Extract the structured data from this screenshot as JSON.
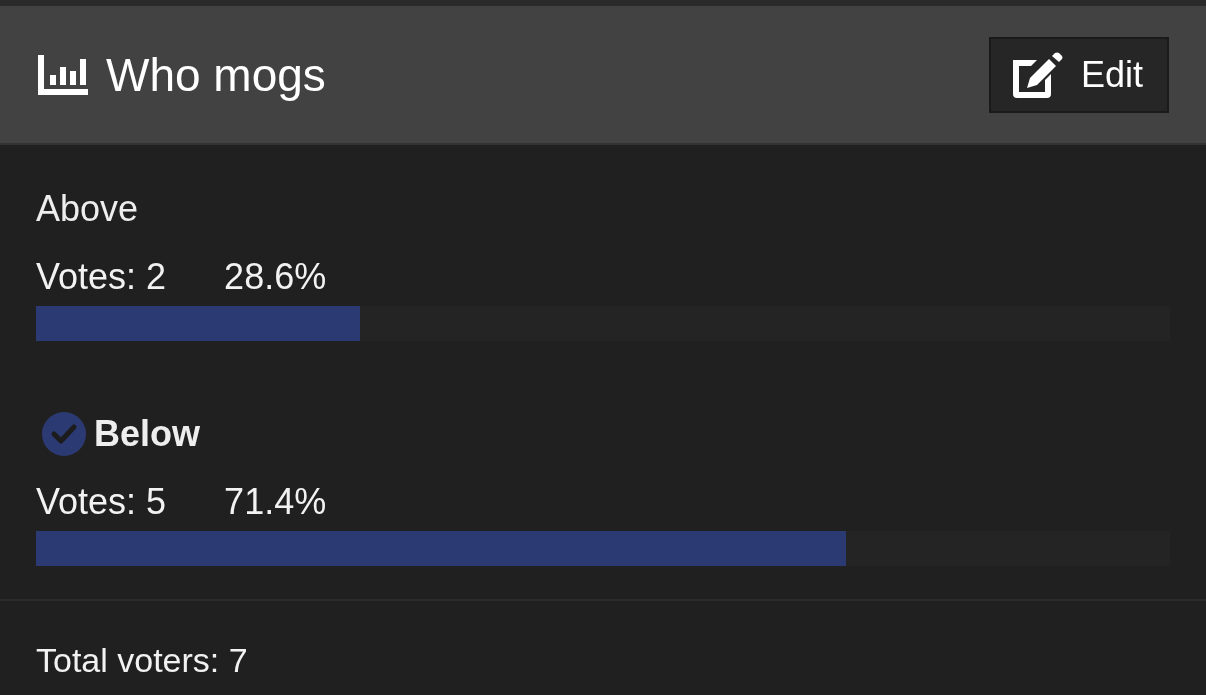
{
  "poll": {
    "title": "Who mogs",
    "edit_button": "Edit"
  },
  "options": [
    {
      "label": "Above",
      "selected": false,
      "votes": "Votes: 2",
      "percent": "28.6%",
      "level": 0.286
    },
    {
      "label": "Below",
      "selected": true,
      "votes": "Votes: 5",
      "percent": "71.4%",
      "level": 0.714
    }
  ],
  "footer": {
    "total": "Total voters: 7"
  }
}
